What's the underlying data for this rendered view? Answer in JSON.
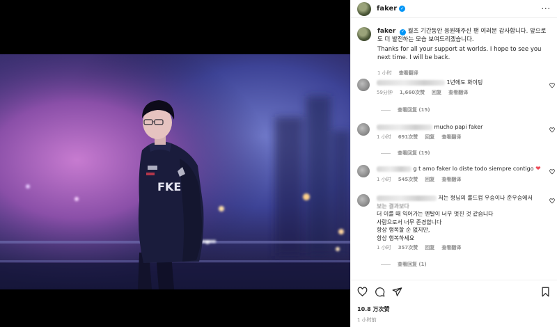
{
  "header": {
    "username": "faker",
    "more_label": "···"
  },
  "caption": {
    "username": "faker",
    "text_ko": "월즈 기간동안 응원해주신 팬 여러분 감사합니다. 앞으로도 더 발전하는 모습 보여드리겠습니다.",
    "text_en": "Thanks for all your support at worlds. I hope to see you next time. I will be back.",
    "time": "1 小时",
    "translate": "查看翻译"
  },
  "comments": [
    {
      "text": "1년에도 화이팅",
      "time": "59分钟",
      "likes": "1,660次赞",
      "reply": "回复",
      "translate": "查看翻译",
      "replies": "查看回复 (15)"
    },
    {
      "text": "mucho papi faker",
      "time": "1 小时",
      "likes": "691次赞",
      "reply": "回复",
      "translate": "查看翻译",
      "replies": "查看回复 (19)"
    },
    {
      "text": "g t amo faker lo diste todo siempre contigo",
      "time": "1 小时",
      "likes": "545次赞",
      "reply": "回复",
      "translate": "查看翻译"
    },
    {
      "line1": "저는 형님의 롤드컵 우승이나 준우승에서",
      "line2": "보는 결과보다",
      "line3": "더 이룰 때 익어가는 멘탈이 너무 멋진 것 같습니다",
      "line4": "사람으로서 너무 존경합니다",
      "line5": "항상 행복할 순 없지만,",
      "line6": "항상 행복하세요",
      "time": "1 小时",
      "likes": "357次赞",
      "reply": "回复",
      "translate": "查看翻译",
      "replies": "查看回复 (1)"
    }
  ],
  "footer": {
    "likes": "10.8 万次赞",
    "time": "1 小时前"
  },
  "photo": {
    "jersey_text": "FKE"
  },
  "colors": {
    "accent": "#0095f6",
    "heart": "#ed4956"
  }
}
